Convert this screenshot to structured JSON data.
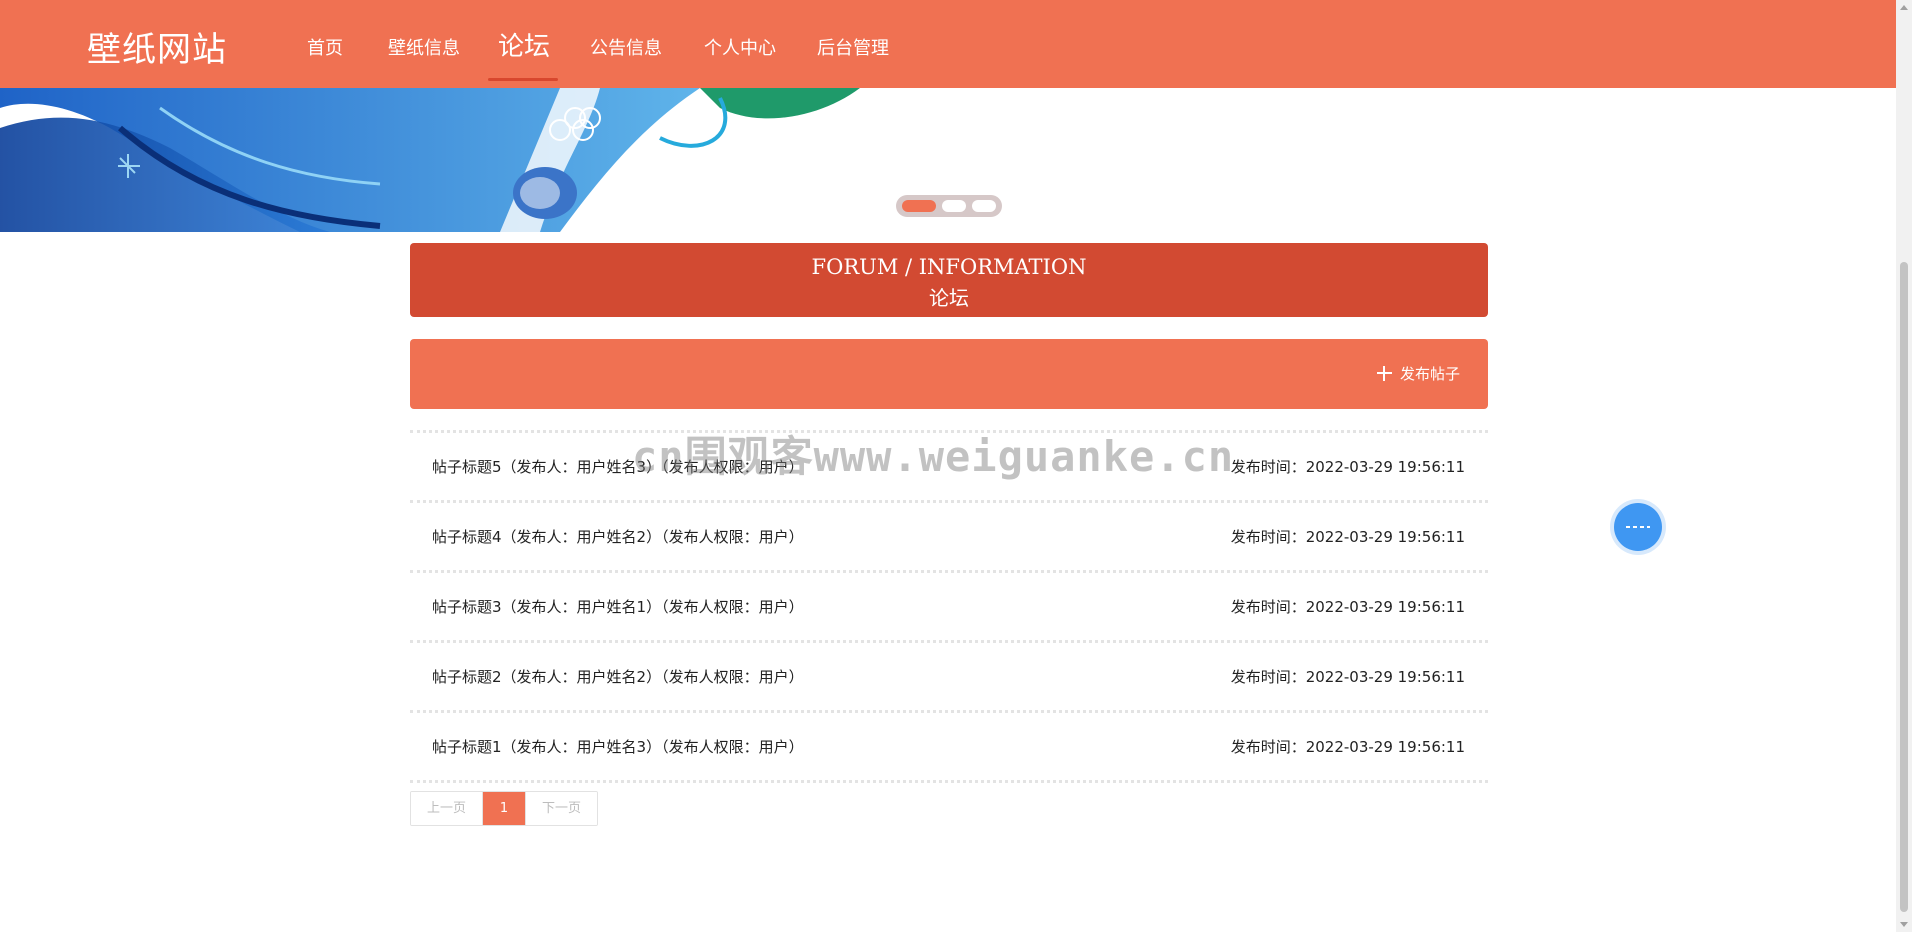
{
  "header": {
    "brand": "壁纸网站",
    "nav": [
      {
        "label": "首页"
      },
      {
        "label": "壁纸信息"
      },
      {
        "label": "论坛"
      },
      {
        "label": "公告信息"
      },
      {
        "label": "个人中心"
      },
      {
        "label": "后台管理"
      }
    ],
    "active_index": 2
  },
  "banner": {
    "slides": 3,
    "active_slide": 1
  },
  "forum": {
    "title_en": "FORUM / INFORMATION",
    "title_cn": "论坛",
    "publish_label": "发布帖子"
  },
  "posts": [
    {
      "title": "帖子标题5（发布人：用户姓名3）（发布人权限：用户）",
      "time": "发布时间：2022-03-29 19:56:11"
    },
    {
      "title": "帖子标题4（发布人：用户姓名2）（发布人权限：用户）",
      "time": "发布时间：2022-03-29 19:56:11"
    },
    {
      "title": "帖子标题3（发布人：用户姓名1）（发布人权限：用户）",
      "time": "发布时间：2022-03-29 19:56:11"
    },
    {
      "title": "帖子标题2（发布人：用户姓名2）（发布人权限：用户）",
      "time": "发布时间：2022-03-29 19:56:11"
    },
    {
      "title": "帖子标题1（发布人：用户姓名3）（发布人权限：用户）",
      "time": "发布时间：2022-03-29 19:56:11"
    }
  ],
  "pagination": {
    "prev": "上一页",
    "current": "1",
    "next": "下一页"
  },
  "watermark": "cn围观客www.weiguanke.cn",
  "colors": {
    "primary": "#f07152",
    "header_block": "#d24a32",
    "float_button": "#3f97f2"
  }
}
